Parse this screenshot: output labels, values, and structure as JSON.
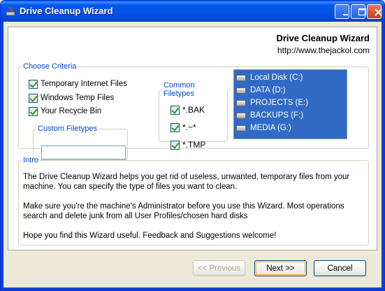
{
  "window": {
    "title": "Drive Cleanup Wizard"
  },
  "header": {
    "title": "Drive Cleanup Wizard",
    "url": "http://www.thejackol.com"
  },
  "criteria": {
    "legend": "Choose Criteria",
    "options": [
      {
        "label": "Temporary Internet Files",
        "checked": true
      },
      {
        "label": "Windows Temp Files",
        "checked": true
      },
      {
        "label": "Your Recycle Bin",
        "checked": true
      }
    ],
    "custom": {
      "legend": "Custom Filetypes",
      "value": ""
    },
    "filetypes": {
      "legend": "Common Filetypes",
      "items": [
        {
          "label": "*.BAK",
          "checked": true
        },
        {
          "label": "*.~*",
          "checked": true
        },
        {
          "label": "*.TMP",
          "checked": true
        }
      ]
    },
    "drives": [
      "Local Disk (C:)",
      "DATA (D:)",
      "PROJECTS (E:)",
      "BACKUPS (F:)",
      "MEDIA (G:)"
    ]
  },
  "intro": {
    "legend": "Intro",
    "paragraphs": [
      "The Drive Cleanup Wizard helps you get rid of useless, unwanted, temporary files from your machine. You can specify the type of files you want to clean.",
      "Make sure you're the machine's Administrator before you use this Wizard. Most operations search and delete junk from all User Profiles/chosen hard disks",
      "Hope you find this Wizard useful. Feedback and Suggestions welcome!"
    ]
  },
  "buttons": {
    "previous": "<< Previous",
    "next": "Next >>",
    "cancel": "Cancel"
  },
  "colors": {
    "titlebar": "#0054E3",
    "selection": "#316AC5",
    "legend": "#0046D5"
  }
}
